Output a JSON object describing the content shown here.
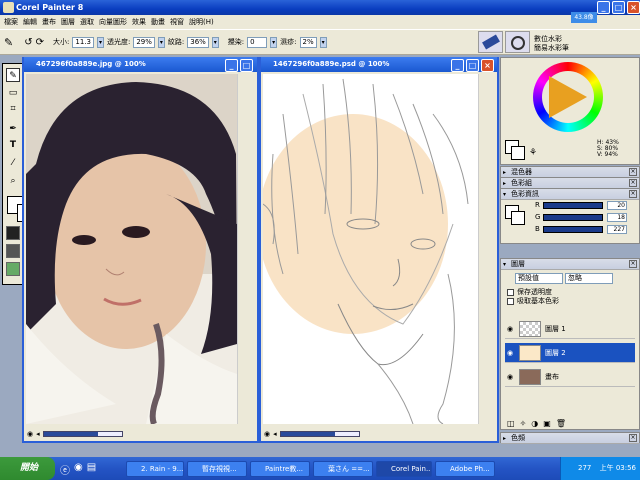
{
  "app": {
    "title": "Corel Painter 8"
  },
  "menu": [
    "檔案",
    "編輯",
    "畫布",
    "圖層",
    "選取",
    "向量圖形",
    "效果",
    "動畫",
    "視窗",
    "說明(H)"
  ],
  "propbar": {
    "size_label": "大小:",
    "size_value": "11.3",
    "opacity_label": "透光度:",
    "opacity_value": "29%",
    "grain_label": "紋路:",
    "grain_value": "36%",
    "resat_label": "攪染:",
    "resat_value": "0",
    "bleed_label": "濕疹:",
    "bleed_value": "2%"
  },
  "brush_selector": {
    "category": "數位水彩",
    "variant": "簡易水彩筆",
    "size_badge": "43.8像"
  },
  "doc1": {
    "title": "467296f0a889e.jpg @ 100%"
  },
  "doc2": {
    "title": "1467296f0a889e.psd @ 100%"
  },
  "color_panel": {
    "h": "H: 43%",
    "s": "S: 80%",
    "v": "V: 94%"
  },
  "panels": {
    "mixer": "混色器",
    "sets": "色彩組",
    "info": "色彩資訊",
    "layers": "圖層",
    "channels": "色頻"
  },
  "color_info": {
    "r": "R",
    "g": "G",
    "b": "B",
    "r_value": "20",
    "g_value": "18",
    "b_value": "227"
  },
  "layers": {
    "composite": "預設值",
    "mode": "忽略",
    "preserve": "保存透明度",
    "pick": "吸取基本色彩",
    "items": [
      {
        "name": "圖層 1"
      },
      {
        "name": "圖層 2"
      },
      {
        "name": "畫布"
      }
    ]
  },
  "taskbar": {
    "start": "開始",
    "buttons": [
      "2. Rain - 9...",
      "暫存視視...",
      "Paintre教...",
      "葉さん ==...",
      "Corel Pain...",
      "Adobe Ph..."
    ],
    "clock": "上午 03:56",
    "tray_num": "277"
  },
  "colors": {
    "accent": "#0a3ec0",
    "desktop": "#9ba9c0",
    "sketch_fill": "#f8dcb8"
  }
}
